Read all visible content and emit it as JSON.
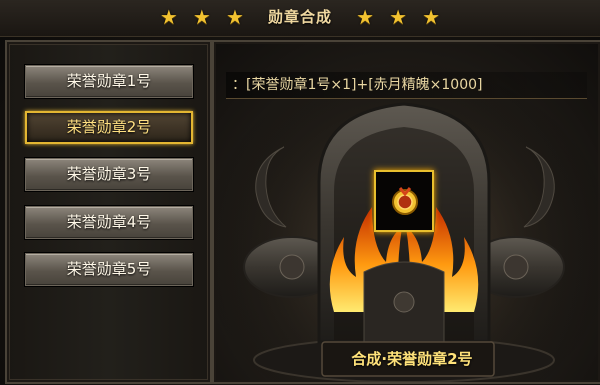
{
  "title": {
    "text": "勋章合成",
    "stars_left": [
      "★",
      "★",
      "★"
    ],
    "stars_right": [
      "★",
      "★",
      "★"
    ]
  },
  "medals": [
    {
      "label": "荣誉勋章1号",
      "selected": false
    },
    {
      "label": "荣誉勋章2号",
      "selected": true
    },
    {
      "label": "荣誉勋章3号",
      "selected": false
    },
    {
      "label": "荣誉勋章4号",
      "selected": false
    },
    {
      "label": "荣誉勋章5号",
      "selected": false
    }
  ],
  "recipe": {
    "text": "：[荣誉勋章1号×1]+[赤月精魄×1000]"
  },
  "result": {
    "slot_icon": "medal-icon",
    "name": "合成·荣誉勋章2号"
  },
  "colors": {
    "gold_accent": "#e3b632",
    "star": "#f2c230",
    "title_text": "#f0d8a0"
  }
}
